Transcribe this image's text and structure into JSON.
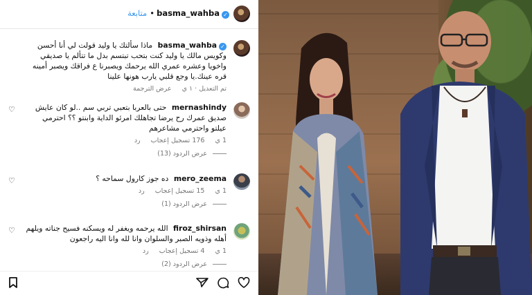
{
  "header": {
    "username": "basma_wahba",
    "follow_label": "متابعة",
    "separator": "•"
  },
  "caption": {
    "username": "basma_wahba",
    "text": "ماذا سألتك يا وليد قولت لي أنا أحسن وكويس مالك يا وليد كنت بتحب تبتسم بدل ما تتألم يا صديقي واخويا وعشره عمري الله يرحمك ويصبرنا ع فراقك ويصبر أمينه قره عينك.يا وجع قلبي يارب هونها علينا",
    "meta_edited": "تم التعديل · ١ ي",
    "meta_translate": "عرض الترجمة"
  },
  "comments": [
    {
      "username": "mernashindy",
      "text": "حتى بالعربا بتعبي تربي سم ..لو كان عايش صديق عمرك رح يرضا تجاهلك امرئو الداية وابنتو ؟؟ احترمي عيلتو واحترمي مشاعرهم",
      "age": "1 ي",
      "likes": "176 تسجيل إعجاب",
      "reply": "رد",
      "view_replies": "عرض الردود (13)"
    },
    {
      "username": "mero_zeema",
      "text": "ده جوز كارول سماحه ؟",
      "age": "1 ي",
      "likes": "15 تسجيل إعجاب",
      "reply": "رد",
      "view_replies": "عرض الردود (1)"
    },
    {
      "username": "firoz_shirsan",
      "text": "الله يرحمه ويغفر له ويسكنه فسيح جناته ويلهم أهله وذويه الصبر والسلوان وانا لله وانا اليه راجعون",
      "age": "1 ي",
      "likes": "4 تسجيل إعجاب",
      "reply": "رد",
      "view_replies": "عرض الردود (2)"
    }
  ],
  "icons": {
    "bookmark": "bookmark-icon",
    "share": "share-icon",
    "comment": "comment-icon",
    "like": "heart-icon"
  },
  "colors": {
    "accent": "#3897f0",
    "muted": "#737373"
  }
}
